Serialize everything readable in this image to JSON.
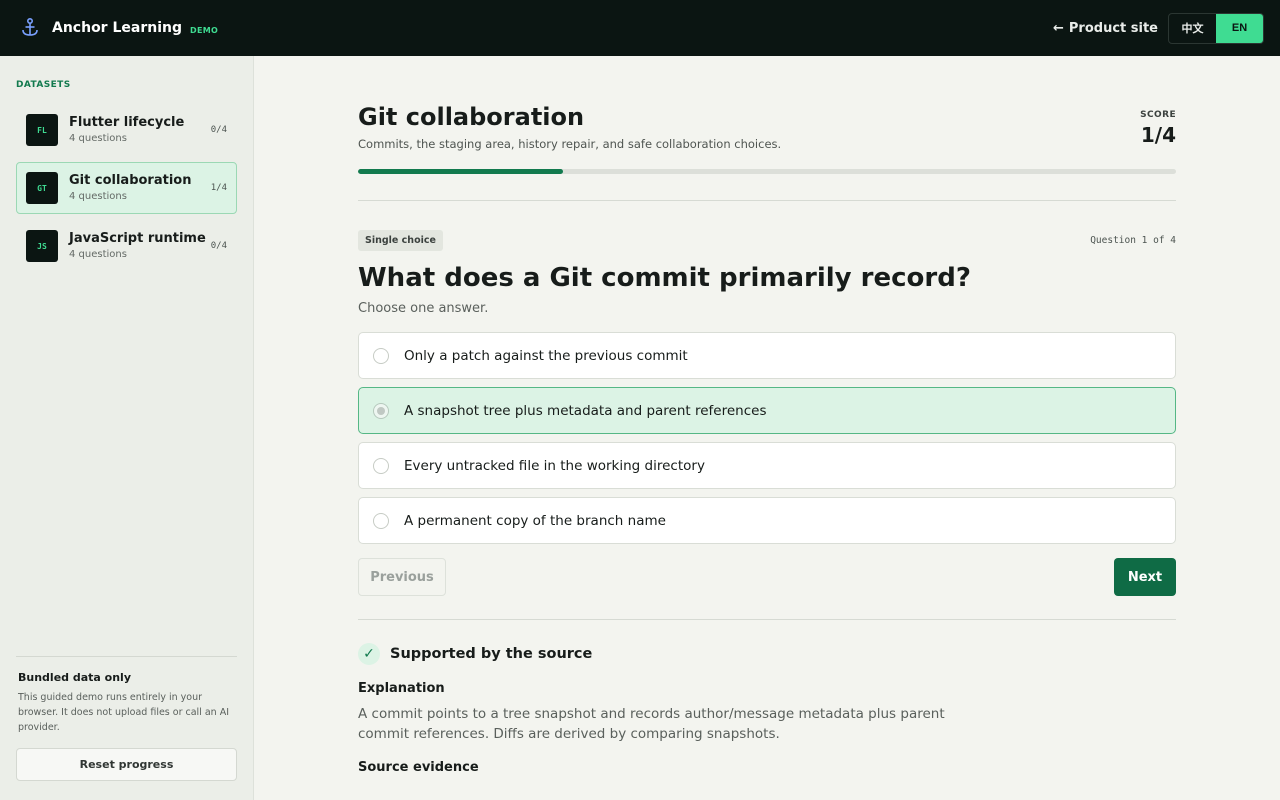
{
  "header": {
    "brand_name": "Anchor Learning",
    "brand_tag": "DEMO",
    "product_link": "Product site",
    "lang_zh": "中文",
    "lang_en": "EN",
    "active_lang": "EN"
  },
  "sidebar": {
    "heading": "DATASETS",
    "datasets": [
      {
        "badge": "FL",
        "title": "Flutter lifecycle",
        "subtitle": "4 questions",
        "count": "0/4",
        "active": false
      },
      {
        "badge": "GT",
        "title": "Git collaboration",
        "subtitle": "4 questions",
        "count": "1/4",
        "active": true
      },
      {
        "badge": "JS",
        "title": "JavaScript runtime",
        "subtitle": "4 questions",
        "count": "0/4",
        "active": false
      }
    ],
    "footer": {
      "title": "Bundled data only",
      "text": "This guided demo runs entirely in your browser. It does not upload files or call an AI provider.",
      "reset_label": "Reset progress"
    }
  },
  "quiz": {
    "title": "Git collaboration",
    "description": "Commits, the staging area, history repair, and safe collaboration choices.",
    "score_label": "SCORE",
    "score_value": "1/4",
    "progress_fraction": 0.25
  },
  "question": {
    "type": "Single choice",
    "counter": "Question 1 of 4",
    "text": "What does a Git commit primarily record?",
    "hint": "Choose one answer.",
    "options": [
      {
        "label": "Only a patch against the previous commit",
        "selected": false
      },
      {
        "label": "A snapshot tree plus metadata and parent references",
        "selected": true
      },
      {
        "label": "Every untracked file in the working directory",
        "selected": false
      },
      {
        "label": "A permanent copy of the branch name",
        "selected": false
      }
    ],
    "prev_label": "Previous",
    "next_label": "Next"
  },
  "feedback": {
    "check_icon": "✓",
    "status": "Supported by the source",
    "explanation_title": "Explanation",
    "explanation_text": "A commit points to a tree snapshot and records author/message metadata plus parent commit references. Diffs are derived by comparing snapshots.",
    "source_title": "Source evidence"
  }
}
